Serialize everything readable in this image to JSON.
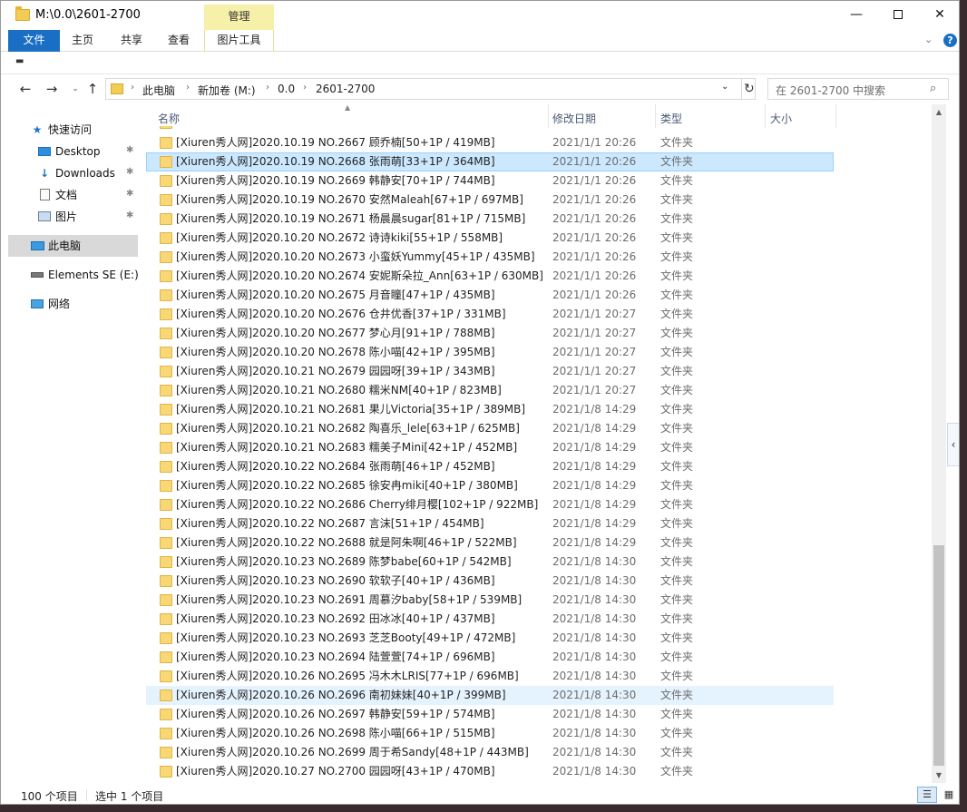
{
  "window": {
    "title": "M:\\0.0\\2601-2700",
    "context_tab": "管理",
    "minimize": "—",
    "close": "✕"
  },
  "ribbon": {
    "tabs": [
      "文件",
      "主页",
      "共享",
      "查看",
      "图片工具"
    ]
  },
  "address": {
    "crumbs": [
      "此电脑",
      "新加卷 (M:)",
      "0.0",
      "2601-2700"
    ]
  },
  "search": {
    "placeholder": "在 2601-2700 中搜索"
  },
  "nav": {
    "quick_access": "快速访问",
    "desktop": "Desktop",
    "downloads": "Downloads",
    "documents": "文档",
    "pictures": "图片",
    "this_pc": "此电脑",
    "drive": "Elements SE (E:)",
    "network": "网络"
  },
  "columns": {
    "name": "名称",
    "date": "修改日期",
    "type": "类型",
    "size": "大小"
  },
  "files": [
    {
      "name": "[Xiuren秀人网]2020.10.19 NO.2667 顾乔楠[50+1P / 419MB]",
      "date": "2021/1/1 20:26",
      "type": "文件夹"
    },
    {
      "name": "[Xiuren秀人网]2020.10.19 NO.2668 张雨萌[33+1P / 364MB]",
      "date": "2021/1/1 20:26",
      "type": "文件夹"
    },
    {
      "name": "[Xiuren秀人网]2020.10.19 NO.2669 韩静安[70+1P / 744MB]",
      "date": "2021/1/1 20:26",
      "type": "文件夹"
    },
    {
      "name": "[Xiuren秀人网]2020.10.19 NO.2670 安然Maleah[67+1P / 697MB]",
      "date": "2021/1/1 20:26",
      "type": "文件夹"
    },
    {
      "name": "[Xiuren秀人网]2020.10.19 NO.2671 杨晨晨sugar[81+1P / 715MB]",
      "date": "2021/1/1 20:26",
      "type": "文件夹"
    },
    {
      "name": "[Xiuren秀人网]2020.10.20 NO.2672 诗诗kiki[55+1P / 558MB]",
      "date": "2021/1/1 20:26",
      "type": "文件夹"
    },
    {
      "name": "[Xiuren秀人网]2020.10.20 NO.2673 小蛮妖Yummy[45+1P / 435MB]",
      "date": "2021/1/1 20:26",
      "type": "文件夹"
    },
    {
      "name": "[Xiuren秀人网]2020.10.20 NO.2674 安妮斯朵拉_Ann[63+1P / 630MB]",
      "date": "2021/1/1 20:26",
      "type": "文件夹"
    },
    {
      "name": "[Xiuren秀人网]2020.10.20 NO.2675 月音瞳[47+1P / 435MB]",
      "date": "2021/1/1 20:26",
      "type": "文件夹"
    },
    {
      "name": "[Xiuren秀人网]2020.10.20 NO.2676 仓井优香[37+1P / 331MB]",
      "date": "2021/1/1 20:27",
      "type": "文件夹"
    },
    {
      "name": "[Xiuren秀人网]2020.10.20 NO.2677 梦心月[91+1P / 788MB]",
      "date": "2021/1/1 20:27",
      "type": "文件夹"
    },
    {
      "name": "[Xiuren秀人网]2020.10.20 NO.2678 陈小喵[42+1P / 395MB]",
      "date": "2021/1/1 20:27",
      "type": "文件夹"
    },
    {
      "name": "[Xiuren秀人网]2020.10.21 NO.2679 园园呀[39+1P / 343MB]",
      "date": "2021/1/1 20:27",
      "type": "文件夹"
    },
    {
      "name": "[Xiuren秀人网]2020.10.21 NO.2680 糯米NM[40+1P / 823MB]",
      "date": "2021/1/1 20:27",
      "type": "文件夹"
    },
    {
      "name": "[Xiuren秀人网]2020.10.21 NO.2681 果儿Victoria[35+1P / 389MB]",
      "date": "2021/1/8 14:29",
      "type": "文件夹"
    },
    {
      "name": "[Xiuren秀人网]2020.10.21 NO.2682 陶喜乐_lele[63+1P / 625MB]",
      "date": "2021/1/8 14:29",
      "type": "文件夹"
    },
    {
      "name": "[Xiuren秀人网]2020.10.21 NO.2683 糯美子Mini[42+1P / 452MB]",
      "date": "2021/1/8 14:29",
      "type": "文件夹"
    },
    {
      "name": "[Xiuren秀人网]2020.10.22 NO.2684 张雨萌[46+1P / 452MB]",
      "date": "2021/1/8 14:29",
      "type": "文件夹"
    },
    {
      "name": "[Xiuren秀人网]2020.10.22 NO.2685 徐安冉miki[40+1P / 380MB]",
      "date": "2021/1/8 14:29",
      "type": "文件夹"
    },
    {
      "name": "[Xiuren秀人网]2020.10.22 NO.2686 Cherry绯月樱[102+1P / 922MB]",
      "date": "2021/1/8 14:29",
      "type": "文件夹"
    },
    {
      "name": "[Xiuren秀人网]2020.10.22 NO.2687 言沫[51+1P / 454MB]",
      "date": "2021/1/8 14:29",
      "type": "文件夹"
    },
    {
      "name": "[Xiuren秀人网]2020.10.22 NO.2688 就是阿朱啊[46+1P / 522MB]",
      "date": "2021/1/8 14:29",
      "type": "文件夹"
    },
    {
      "name": "[Xiuren秀人网]2020.10.23 NO.2689 陈梦babe[60+1P / 542MB]",
      "date": "2021/1/8 14:30",
      "type": "文件夹"
    },
    {
      "name": "[Xiuren秀人网]2020.10.23 NO.2690 软软子[40+1P / 436MB]",
      "date": "2021/1/8 14:30",
      "type": "文件夹"
    },
    {
      "name": "[Xiuren秀人网]2020.10.23 NO.2691 周慕汐baby[58+1P / 539MB]",
      "date": "2021/1/8 14:30",
      "type": "文件夹"
    },
    {
      "name": "[Xiuren秀人网]2020.10.23 NO.2692 田冰冰[40+1P / 437MB]",
      "date": "2021/1/8 14:30",
      "type": "文件夹"
    },
    {
      "name": "[Xiuren秀人网]2020.10.23 NO.2693 芝芝Booty[49+1P / 472MB]",
      "date": "2021/1/8 14:30",
      "type": "文件夹"
    },
    {
      "name": "[Xiuren秀人网]2020.10.23 NO.2694 陆萱萱[74+1P / 696MB]",
      "date": "2021/1/8 14:30",
      "type": "文件夹"
    },
    {
      "name": "[Xiuren秀人网]2020.10.26 NO.2695 冯木木LRIS[77+1P / 696MB]",
      "date": "2021/1/8 14:30",
      "type": "文件夹"
    },
    {
      "name": "[Xiuren秀人网]2020.10.26 NO.2696 南初妹妹[40+1P / 399MB]",
      "date": "2021/1/8 14:30",
      "type": "文件夹"
    },
    {
      "name": "[Xiuren秀人网]2020.10.26 NO.2697 韩静安[59+1P / 574MB]",
      "date": "2021/1/8 14:30",
      "type": "文件夹"
    },
    {
      "name": "[Xiuren秀人网]2020.10.26 NO.2698 陈小喵[66+1P / 515MB]",
      "date": "2021/1/8 14:30",
      "type": "文件夹"
    },
    {
      "name": "[Xiuren秀人网]2020.10.26 NO.2699 周于希Sandy[48+1P / 443MB]",
      "date": "2021/1/8 14:30",
      "type": "文件夹"
    },
    {
      "name": "[Xiuren秀人网]2020.10.27 NO.2700 园园呀[43+1P / 470MB]",
      "date": "2021/1/8 14:30",
      "type": "文件夹"
    }
  ],
  "selected_index": 1,
  "hover_index": 29,
  "status": {
    "count": "100 个项目",
    "selection": "选中 1 个项目"
  }
}
